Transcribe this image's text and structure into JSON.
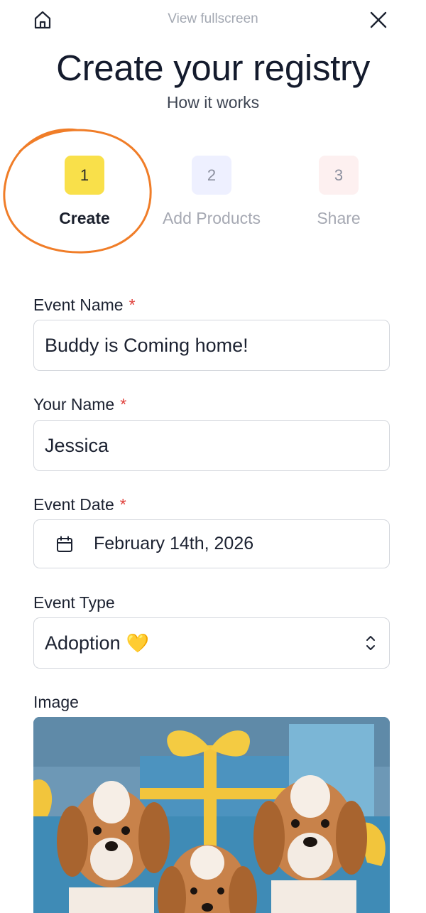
{
  "header": {
    "home_icon": "home-icon",
    "fullscreen_label": "View fullscreen",
    "close_icon": "close-icon"
  },
  "title": "Create your registry",
  "subtitle": "How it works",
  "steps": [
    {
      "number": "1",
      "label": "Create",
      "active": true,
      "color": "#f9e04a"
    },
    {
      "number": "2",
      "label": "Add Products",
      "active": false,
      "color": "#eef0ff"
    },
    {
      "number": "3",
      "label": "Share",
      "active": false,
      "color": "#fdf0f0"
    }
  ],
  "annotation_color": "#f07d28",
  "form": {
    "required_marker": "*",
    "event_name": {
      "label": "Event Name",
      "value": "Buddy is Coming home!"
    },
    "your_name": {
      "label": "Your Name",
      "value": "Jessica"
    },
    "event_date": {
      "label": "Event Date",
      "value": "February 14th, 2026",
      "icon": "calendar-icon"
    },
    "event_type": {
      "label": "Event Type",
      "value": "Adoption",
      "emoji": "💛",
      "icon": "chevron-up-down-icon"
    },
    "image": {
      "label": "Image"
    }
  },
  "colors": {
    "required": "#e0403b",
    "border": "#d4d7dd",
    "text": "#1c2231"
  }
}
